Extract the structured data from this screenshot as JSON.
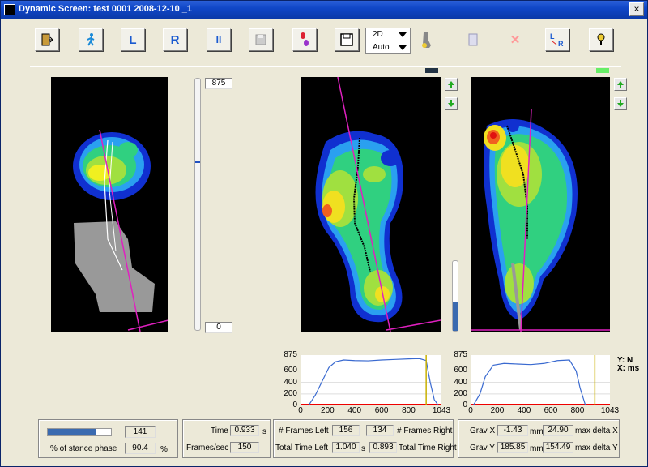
{
  "window": {
    "title": "Dynamic Screen: test 0001 2008-12-10 _1",
    "close_label": "×"
  },
  "toolbar": {
    "left_label": "L",
    "right_label": "R",
    "pause_label": "II",
    "view_mode": "2D",
    "scale_mode": "Auto"
  },
  "left_slider": {
    "max": "875",
    "min": "0",
    "value_fraction": 0.35
  },
  "right_panel": {
    "fill_fraction": 0.42
  },
  "charts": {
    "legend": {
      "y": "Y: N",
      "x": "X: ms"
    },
    "left": {
      "y_ticks": [
        "875",
        "600",
        "400",
        "200",
        "0"
      ],
      "x_ticks": [
        "0",
        "200",
        "400",
        "600",
        "800",
        "1043"
      ]
    },
    "right": {
      "y_ticks": [
        "875",
        "600",
        "400",
        "200",
        "0"
      ],
      "x_ticks": [
        "0",
        "200",
        "400",
        "600",
        "800",
        "1043"
      ]
    }
  },
  "chart_data": [
    {
      "type": "line",
      "xlim": [
        0,
        1043
      ],
      "ylim": [
        0,
        875
      ],
      "marker_x": 930,
      "series": [
        {
          "values": [
            [
              60,
              0
            ],
            [
              110,
              180
            ],
            [
              160,
              420
            ],
            [
              210,
              660
            ],
            [
              260,
              760
            ],
            [
              320,
              790
            ],
            [
              400,
              780
            ],
            [
              500,
              775
            ],
            [
              600,
              790
            ],
            [
              700,
              800
            ],
            [
              800,
              810
            ],
            [
              880,
              815
            ],
            [
              930,
              780
            ],
            [
              960,
              400
            ],
            [
              990,
              100
            ],
            [
              1020,
              0
            ]
          ]
        }
      ]
    },
    {
      "type": "line",
      "xlim": [
        0,
        1043
      ],
      "ylim": [
        0,
        875
      ],
      "marker_x": 930,
      "series": [
        {
          "values": [
            [
              20,
              0
            ],
            [
              70,
              200
            ],
            [
              110,
              500
            ],
            [
              170,
              700
            ],
            [
              250,
              730
            ],
            [
              350,
              720
            ],
            [
              450,
              710
            ],
            [
              550,
              730
            ],
            [
              650,
              780
            ],
            [
              740,
              790
            ],
            [
              790,
              600
            ],
            [
              820,
              300
            ],
            [
              860,
              0
            ]
          ]
        }
      ]
    }
  ],
  "stance": {
    "value": "141",
    "progress": 0.75,
    "label": "% of stance phase",
    "percent": "90.4",
    "unit": "%"
  },
  "timing": {
    "time_label": "Time",
    "time": "0.933",
    "time_unit": "s",
    "fps_label": "Frames/sec",
    "fps": "150"
  },
  "frames": {
    "left_label": "# Frames Left",
    "left": "156",
    "right": "134",
    "right_label": "# Frames Right",
    "tt_left_label": "Total Time Left",
    "tt_left": "1.040",
    "unit": "s",
    "tt_right": "0.893",
    "tt_right_label": "Total Time Right"
  },
  "grav": {
    "x_label": "Grav X",
    "x1": "-1.43",
    "mm": "mm",
    "x2": "24.90",
    "mdx": "max delta X",
    "y_label": "Grav Y",
    "y1": "185.85",
    "y2": "154.49",
    "mdy": "max delta Y"
  }
}
